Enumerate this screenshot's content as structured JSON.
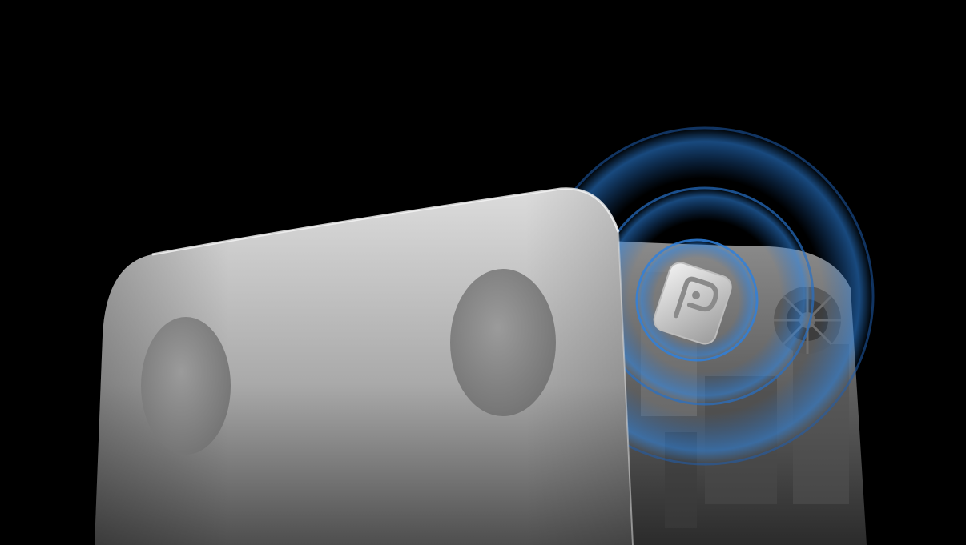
{
  "scene": {
    "subject": "smart-scale-bluetooth-illustration",
    "colors": {
      "background": "#000000",
      "scale_top_light": "#d7d7d7",
      "scale_top_dark": "#5c5c5c",
      "electrode": "#8a8a8a",
      "internals": "#6d6d6d",
      "signal_wave": "#2f7fd6",
      "chip": "#dcdcdc"
    },
    "icons": [
      "bluetooth-chip-icon",
      "signal-wave-icon"
    ]
  }
}
